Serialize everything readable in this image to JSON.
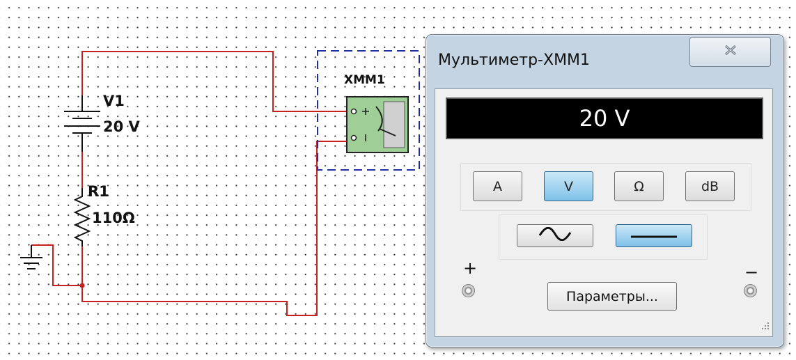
{
  "circuit": {
    "source": {
      "name": "V1",
      "value": "20 V"
    },
    "resistor": {
      "name": "R1",
      "value": "110Ω"
    },
    "multimeter_symbol": {
      "name": "XMM1"
    },
    "colors": {
      "wire": "#c8201f",
      "selection_box": "#1f2ea0",
      "symbol_fill": "#9fcf96"
    }
  },
  "multimeter_window": {
    "title": "Мультиметр-XMM1",
    "close_icon": "close-icon",
    "display": "20 V",
    "mode_buttons": [
      {
        "label": "A",
        "active": false
      },
      {
        "label": "V",
        "active": true
      },
      {
        "label": "Ω",
        "active": false
      },
      {
        "label": "dB",
        "active": false
      }
    ],
    "signal_buttons": [
      {
        "icon": "sine-wave-icon",
        "active": false
      },
      {
        "icon": "dc-line-icon",
        "active": true
      }
    ],
    "params_button": "Параметры...",
    "plus_label": "+",
    "minus_label": "−",
    "colors": {
      "active_button": "#7fc1e8",
      "display_bg": "#000000",
      "frame": "#c5d4e2"
    }
  }
}
